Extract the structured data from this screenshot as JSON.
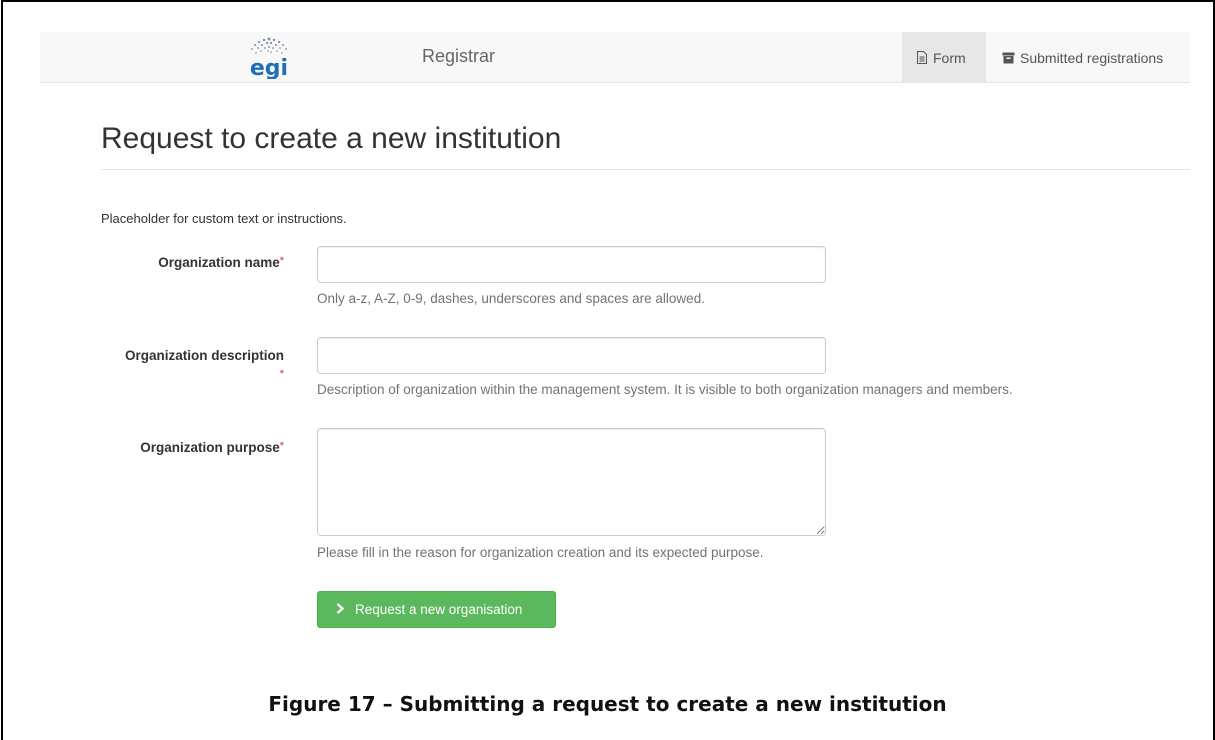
{
  "navbar": {
    "logo_text": "egi",
    "brand": "Registrar",
    "items": [
      {
        "label": "Form",
        "icon": "document-icon",
        "active": true
      },
      {
        "label": "Submitted registrations",
        "icon": "archive-box-icon",
        "active": false
      }
    ]
  },
  "page": {
    "title": "Request to create a new institution",
    "intro": "Placeholder for custom text or instructions."
  },
  "form": {
    "required_mark": "*",
    "fields": [
      {
        "label_line1": "Organization name",
        "label_line2": "",
        "value": "",
        "help": "Only a-z, A-Z, 0-9, dashes, underscores and spaces are allowed."
      },
      {
        "label_line1": "Organization description",
        "label_line2": "",
        "value": "",
        "help": "Description of organization within the management system. It is visible to both organization managers and members."
      },
      {
        "label_line1": "Organization purpose",
        "label_line2": "",
        "value": "",
        "help": "Please fill in the reason for organization creation and its expected purpose."
      }
    ],
    "submit_label": "Request a new organisation"
  },
  "caption": "Figure 17 – Submitting a request to create a new institution",
  "colors": {
    "navbar_bg": "#f8f8f8",
    "active_tab_bg": "#e7e7e7",
    "submit_green": "#5cb85c",
    "logo_blue": "#1e6fb8",
    "required_red": "#c9302c"
  }
}
